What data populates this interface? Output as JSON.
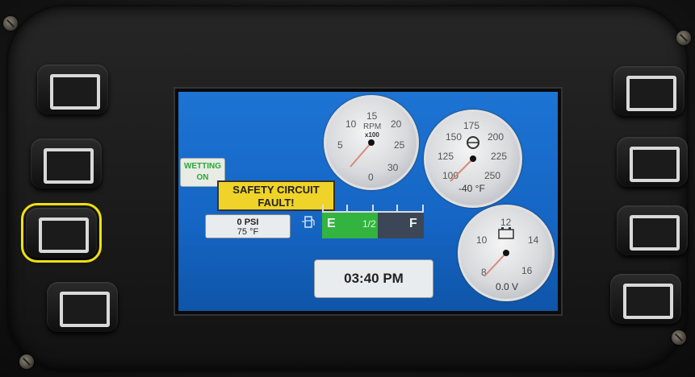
{
  "gauges": {
    "rpm": {
      "ticks": [
        "5",
        "10",
        "15",
        "20",
        "25",
        "30"
      ],
      "zero": "0",
      "unit": "RPM",
      "mult": "x100",
      "value": 0
    },
    "temp": {
      "ticks": [
        "150",
        "175",
        "200",
        "125",
        "225",
        "100",
        "250"
      ],
      "readout": "-40 °F",
      "value": -40
    },
    "volt": {
      "ticks": [
        "10",
        "12",
        "14",
        "16",
        "8"
      ],
      "readout": "0.0 V",
      "value": 0.0
    }
  },
  "indicators": {
    "wetting_line1": "WETTING",
    "wetting_line2": "ON",
    "fault_line1": "SAFETY CIRCUIT",
    "fault_line2": "FAULT!",
    "pressure": "0 PSI",
    "oil_temp": "75 °F"
  },
  "fuel": {
    "empty_label": "E",
    "half_label": "1/2",
    "full_label": "F",
    "level": 0.55
  },
  "clock": {
    "time": "03:40 PM"
  },
  "colors": {
    "screen_bg": "#1565c4",
    "fault": "#f0d328",
    "fuel": "#33b33f",
    "highlight": "#f0e010"
  },
  "icons": [
    "fuel-pump-icon",
    "coolant-temp-icon",
    "battery-icon"
  ]
}
